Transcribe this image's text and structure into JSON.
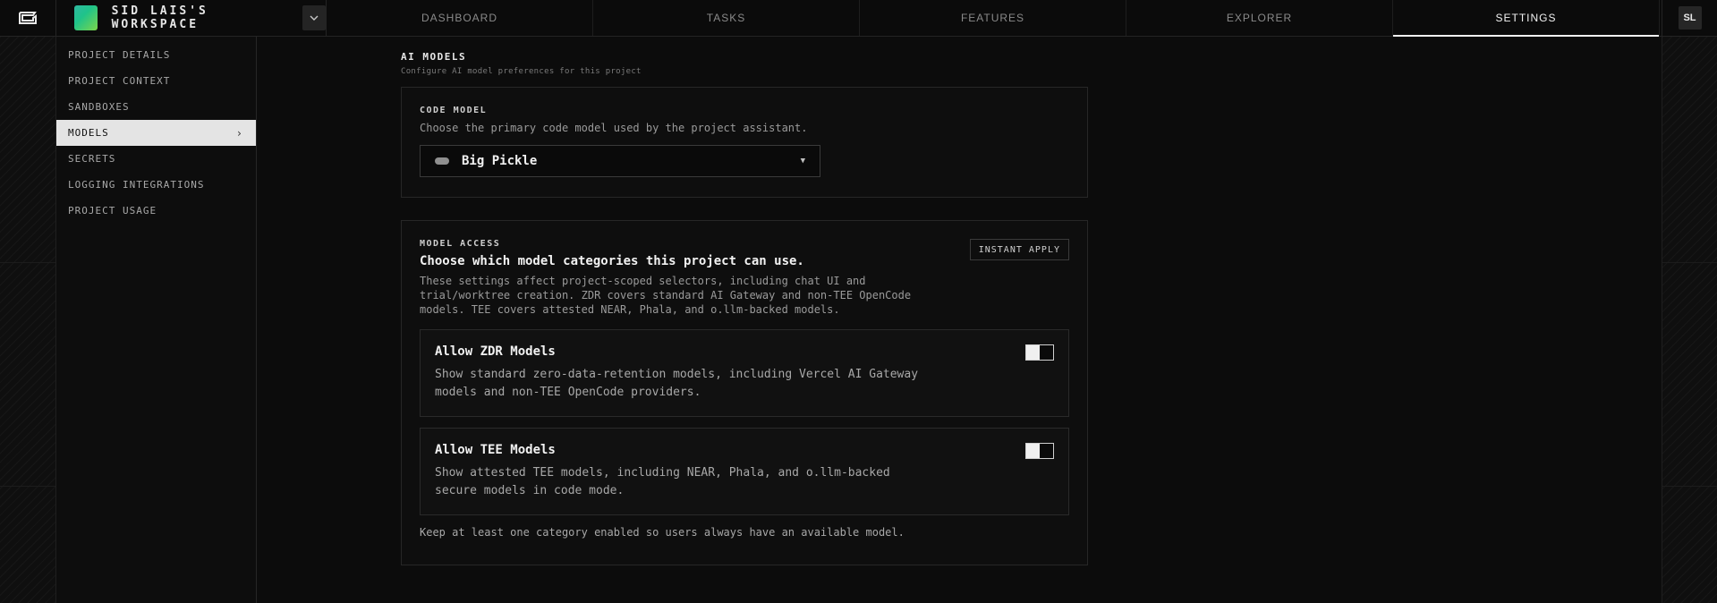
{
  "workspace": {
    "name": "SID LAIS'S WORKSPACE"
  },
  "tabs": [
    {
      "label": "DASHBOARD"
    },
    {
      "label": "TASKS"
    },
    {
      "label": "FEATURES"
    },
    {
      "label": "EXPLORER"
    },
    {
      "label": "SETTINGS",
      "active": true
    }
  ],
  "user": {
    "initials": "SL"
  },
  "sidebar": {
    "items": [
      {
        "label": "PROJECT DETAILS"
      },
      {
        "label": "PROJECT CONTEXT"
      },
      {
        "label": "SANDBOXES"
      },
      {
        "label": "MODELS",
        "active": true
      },
      {
        "label": "SECRETS"
      },
      {
        "label": "LOGGING INTEGRATIONS"
      },
      {
        "label": "PROJECT USAGE"
      }
    ]
  },
  "section": {
    "title": "AI MODELS",
    "subtitle": "Configure AI model preferences for this project"
  },
  "code_model": {
    "label": "CODE MODEL",
    "description": "Choose the primary code model used by the project assistant.",
    "selected": "Big Pickle"
  },
  "model_access": {
    "label": "MODEL ACCESS",
    "badge": "INSTANT APPLY",
    "heading": "Choose which model categories this project can use.",
    "body": "These settings affect project-scoped selectors, including chat UI and trial/worktree creation. ZDR covers standard AI Gateway and non-TEE OpenCode models. TEE covers attested NEAR, Phala, and o.llm-backed models.",
    "zdr": {
      "title": "Allow ZDR Models",
      "description": "Show standard zero-data-retention models, including Vercel AI Gateway models and non-TEE OpenCode providers.",
      "enabled": false
    },
    "tee": {
      "title": "Allow TEE Models",
      "description": "Show attested TEE models, including NEAR, Phala, and o.llm-backed secure models in code mode.",
      "enabled": false
    },
    "footnote": "Keep at least one category enabled so users always have an available model."
  },
  "icons": {
    "logo": "app-logo-icon",
    "workspace_chevron": "chevron-down-icon",
    "sidebar_active_chevron": "chevron-right-icon",
    "model_pill": "model-pill-icon",
    "select_caret": "caret-down-icon"
  }
}
